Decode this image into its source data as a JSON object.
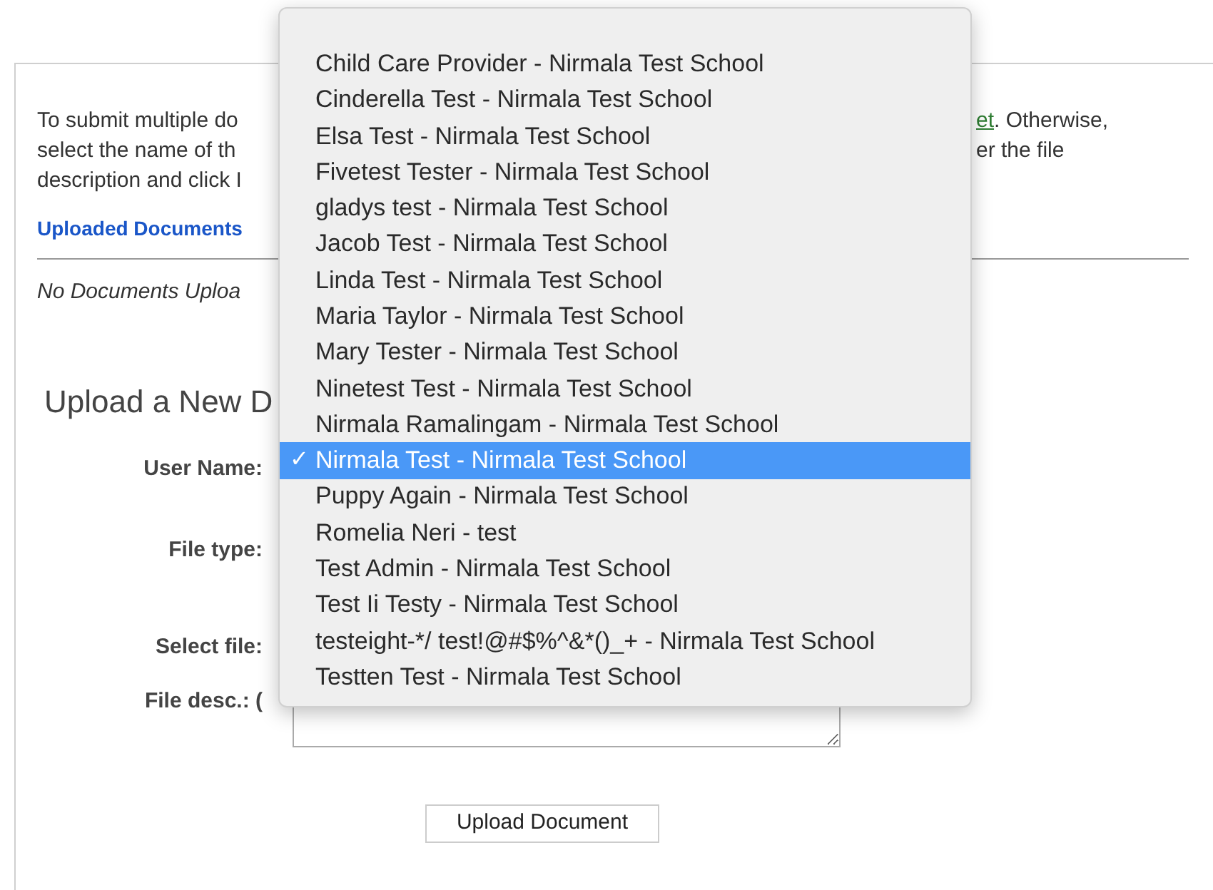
{
  "intro": {
    "lines_left": [
      "To submit multiple do",
      "select the name of th",
      "description and click I"
    ],
    "lines_right": [
      {
        "link": "et",
        "text": ". Otherwise,"
      },
      {
        "text": "er the file"
      }
    ]
  },
  "uploaded_documents": {
    "heading": "Uploaded Documents",
    "empty_message": "No Documents Uploa"
  },
  "upload_form": {
    "heading": "Upload a New D",
    "labels": [
      "User Name:",
      "File type:",
      "Select file:",
      "File desc.: ("
    ],
    "button": "Upload Document"
  },
  "user_menu": {
    "check_mark": "✓",
    "items": [
      {
        "label": "Child Care Provider - Nirmala Test School",
        "selected": false
      },
      {
        "label": "Cinderella Test - Nirmala Test School",
        "selected": false
      },
      {
        "label": "Elsa Test - Nirmala Test School",
        "selected": false
      },
      {
        "label": "Fivetest Tester - Nirmala Test School",
        "selected": false
      },
      {
        "label": "gladys test - Nirmala Test School",
        "selected": false
      },
      {
        "label": "Jacob Test - Nirmala Test School",
        "selected": false
      },
      {
        "label": "Linda Test - Nirmala Test School",
        "selected": false
      },
      {
        "label": "Maria Taylor - Nirmala Test School",
        "selected": false
      },
      {
        "label": "Mary Tester - Nirmala Test School",
        "selected": false
      },
      {
        "label": "Ninetest Test - Nirmala Test School",
        "selected": false
      },
      {
        "label": "Nirmala Ramalingam - Nirmala Test School",
        "selected": false
      },
      {
        "label": "Nirmala Test - Nirmala Test School",
        "selected": true
      },
      {
        "label": "Puppy Again - Nirmala Test School",
        "selected": false
      },
      {
        "label": "Romelia Neri - test",
        "selected": false
      },
      {
        "label": "Test Admin - Nirmala Test School",
        "selected": false
      },
      {
        "label": "Test Ii Testy - Nirmala Test School",
        "selected": false
      },
      {
        "label": "testeight-*/ test!@#$%^&*()_+ - Nirmala Test School",
        "selected": false
      },
      {
        "label": "Testten Test - Nirmala Test School",
        "selected": false
      }
    ]
  }
}
